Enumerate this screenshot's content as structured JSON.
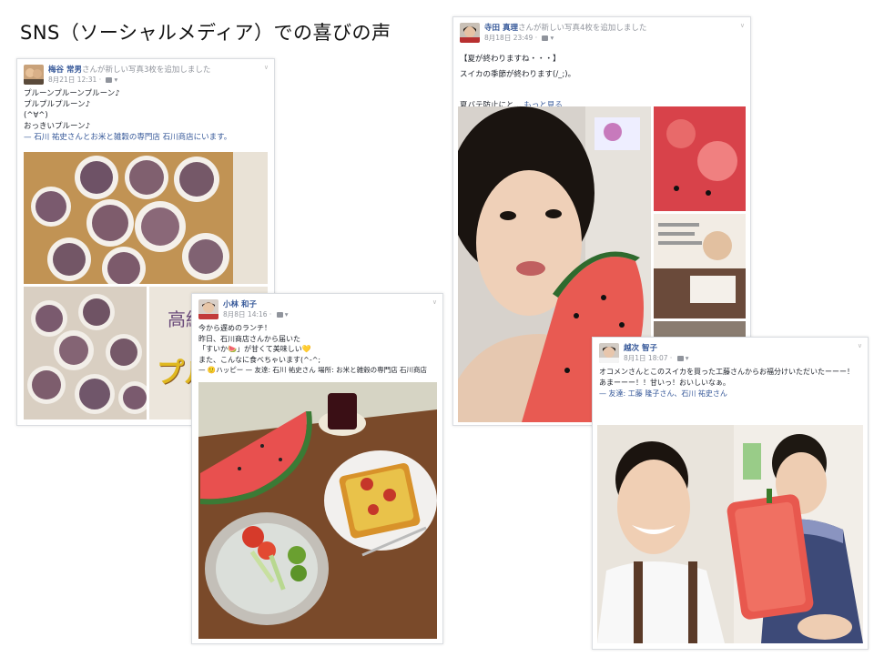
{
  "slide": {
    "title": "SNS（ソーシャルメディア）での喜びの声"
  },
  "post_umetani": {
    "author": "梅谷 常男",
    "action": "さんが新しい写真3枚を追加しました",
    "date": "8月21日 12:31 · ",
    "text": "プルーンプルーンプルーン♪\nプルプルプルーン♪\n(^∀^)\nおっきいプルーン♪",
    "tag": "— 石川 祐史さんとお米と雑穀の専門店 石川商店にいます。",
    "box_label": "高級",
    "box_label2": "プル"
  },
  "post_kobayashi": {
    "author": "小林 和子",
    "date": "8月8日 14:16 · ",
    "text": "今から遅めのランチ！\n昨日、石川商店さんから届いた\n「すいか🍉」が甘くて美味しい💛\nまた、こんなに食べちゃいます(^-^;",
    "tag": "— 🙂ハッピー — 友達: 石川 祐史さん 場所: お米と雑穀の専門店 石川商店"
  },
  "post_terada": {
    "author": "寺田 真理",
    "action": "さんが新しい写真4枚を追加しました",
    "date": "8月18日 23:49 · ",
    "text": "【夏が終わりますね・・・】\nスイカの季節が終わります(/_;)。",
    "text_more_prefix": "夏バテ防止にと... ",
    "text_more_link": "もっと見る"
  },
  "post_koshiji": {
    "author": "越次 智子",
    "date": "8月1日 18:07 · ",
    "text": "オコメンさんとこのスイカを買った工藤さんからお福分けいただいたーーー！\nあまーーー！！甘いっ！おいしいなぁ。",
    "tag": "— 友達: 工藤 隆子さん、石川 祐史さん"
  },
  "colors": {
    "fb_link": "#365899",
    "meta_gray": "#90949c",
    "watermelon": "#e8504f",
    "prune": "#7a5a6e"
  }
}
